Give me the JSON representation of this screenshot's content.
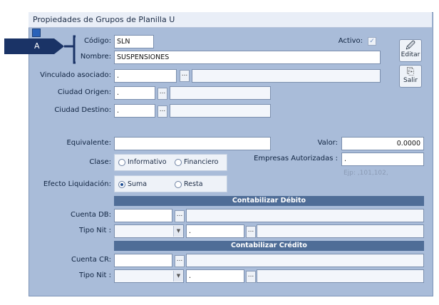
{
  "window": {
    "title": "Propiedades de Grupos de Planilla U"
  },
  "callout": {
    "label": "A"
  },
  "codigo": {
    "label": "Código:",
    "value": "SLN"
  },
  "nombre": {
    "label": "Nombre:",
    "value": "SUSPENSIONES"
  },
  "activo": {
    "label": "Activo:",
    "checked": true,
    "check_glyph": "✓"
  },
  "vinculado": {
    "label": "Vinculado asociado:",
    "value": "."
  },
  "origen": {
    "label": "Ciudad Origen:",
    "value": "."
  },
  "destino": {
    "label": "Ciudad Destino:",
    "value": "."
  },
  "equivalente": {
    "label": "Equivalente:",
    "value": ""
  },
  "valor": {
    "label": "Valor:",
    "value": "0.0000"
  },
  "clase": {
    "label": "Clase:",
    "options": [
      "Informativo",
      "Financiero"
    ],
    "selected": null
  },
  "empresas": {
    "label": "Empresas Autorizadas :",
    "value": ".",
    "hint": "Ejp: ,101,102,"
  },
  "efecto": {
    "label": "Efecto Liquidación:",
    "options": [
      "Suma",
      "Resta"
    ],
    "selected": "Suma"
  },
  "debito": {
    "header": "Contabilizar Débito",
    "cuenta_label": "Cuenta DB:",
    "tiponit_label": "Tipo Nit :",
    "nit_value": "."
  },
  "credito": {
    "header": "Contabilizar Crédito",
    "cuenta_label": "Cuenta CR:",
    "tiponit_label": "Tipo Nit :",
    "nit_value": "."
  },
  "buttons": {
    "editar": "Editar",
    "salir": "Salir",
    "dots": "..."
  },
  "icons": {
    "editar": "edit-icon",
    "salir": "exit-icon",
    "dropdown": "chevron-down-icon"
  },
  "colors": {
    "window_bg": "#a9bcd9",
    "header_bg": "#4f6d97",
    "callout_bg": "#1a3366"
  }
}
